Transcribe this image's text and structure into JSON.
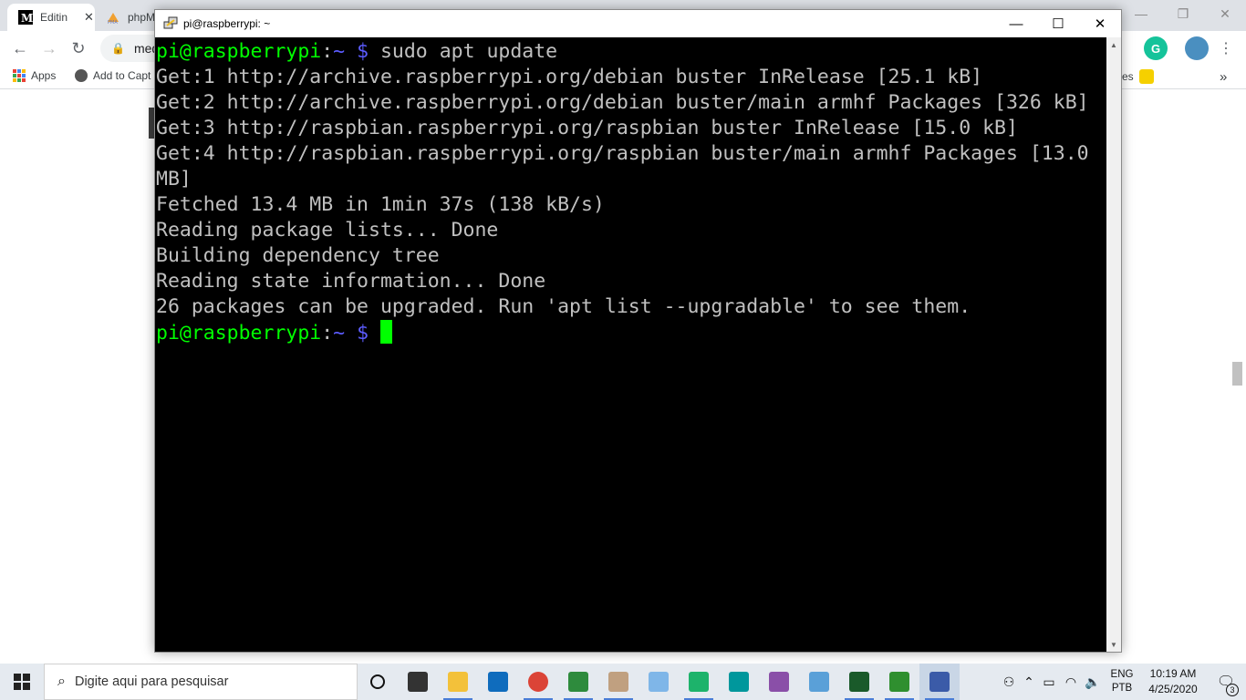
{
  "browser": {
    "tabs": [
      {
        "label": "Editin",
        "icon": "medium-logo-icon",
        "active": true
      },
      {
        "label": "phpM",
        "icon": "phpmyadmin-icon",
        "active": false
      }
    ],
    "tab_close": "✕",
    "address": "med",
    "bookmarks": {
      "apps_label": "Apps",
      "add_to_label": "Add to Capt",
      "fragment_label": "es",
      "more": "»"
    }
  },
  "terminal": {
    "title": "pi@raspberrypi: ~",
    "prompt_user": "pi@raspberrypi",
    "prompt_colon": ":",
    "prompt_path": "~",
    "prompt_dollar": " $ ",
    "command": "sudo apt update",
    "output": [
      "Get:1 http://archive.raspberrypi.org/debian buster InRelease [25.1 kB]",
      "Get:2 http://archive.raspberrypi.org/debian buster/main armhf Packages [326 kB]",
      "Get:3 http://raspbian.raspberrypi.org/raspbian buster InRelease [15.0 kB]",
      "Get:4 http://raspbian.raspberrypi.org/raspbian buster/main armhf Packages [13.0",
      "MB]",
      "Fetched 13.4 MB in 1min 37s (138 kB/s)",
      "Reading package lists... Done",
      "Building dependency tree",
      "Reading state information... Done",
      "26 packages can be upgraded. Run 'apt list --upgradable' to see them."
    ]
  },
  "taskbar": {
    "search_placeholder": "Digite aqui para pesquisar",
    "apps": [
      {
        "name": "task-view",
        "color": "#333333"
      },
      {
        "name": "file-explorer",
        "color": "#f3c13a"
      },
      {
        "name": "mail",
        "color": "#0f6cbd"
      },
      {
        "name": "chrome",
        "color": "#db4437"
      },
      {
        "name": "spreadsheet-app",
        "color": "#2e8b3d"
      },
      {
        "name": "paint",
        "color": "#c0a080"
      },
      {
        "name": "notepad-app",
        "color": "#7fb6e8"
      },
      {
        "name": "node-editor",
        "color": "#1db36b"
      },
      {
        "name": "arduino",
        "color": "#00979c"
      },
      {
        "name": "creature-app",
        "color": "#8a4fa8"
      },
      {
        "name": "network-tool",
        "color": "#5aa0d8"
      },
      {
        "name": "codeblocks-1",
        "color": "#1a5a2a"
      },
      {
        "name": "codeblocks-2",
        "color": "#2f8f2f"
      },
      {
        "name": "putty",
        "color": "#3b5ba8"
      }
    ],
    "lang_top": "ENG",
    "lang_bottom": "PTB",
    "time": "10:19 AM",
    "date": "4/25/2020",
    "notification_count": "3"
  },
  "colors": {
    "prompt_user": "#00ff00",
    "prompt_path": "#5c5cff",
    "terminal_text": "#c0c0c0",
    "terminal_bg": "#000000"
  }
}
